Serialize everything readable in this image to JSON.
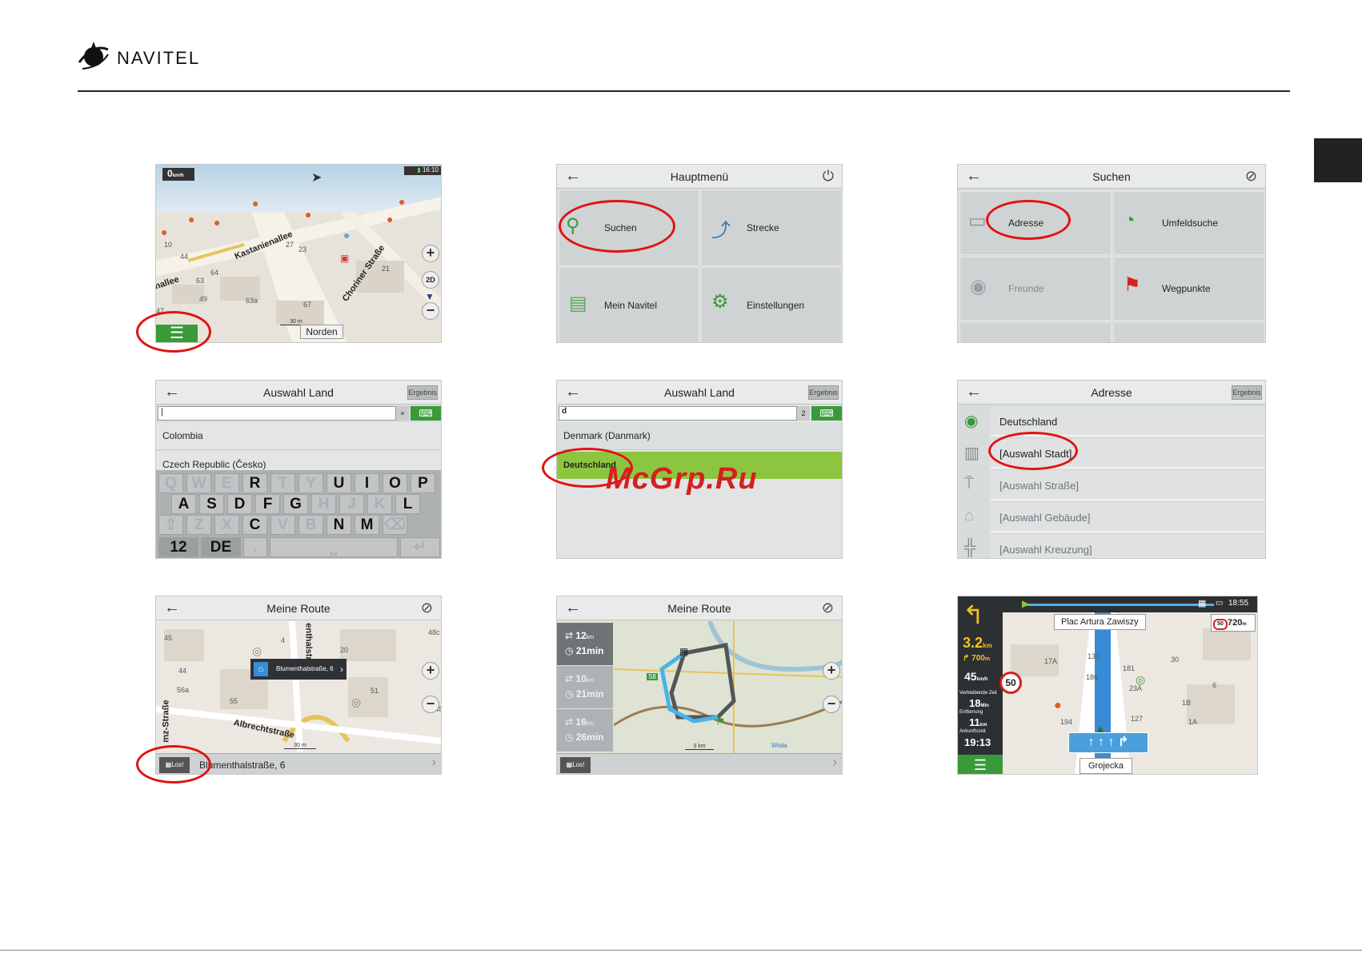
{
  "brand": {
    "name": "NAVITEL"
  },
  "watermark": "McGrp.Ru",
  "map_screen": {
    "speed": "0",
    "speed_unit": "km/h",
    "time": "16:10",
    "streets": [
      "Kastanienallee",
      "Choriner Straße",
      "nallee"
    ],
    "numbers": [
      "44",
      "63",
      "64",
      "49",
      "63a",
      "67",
      "47",
      "27",
      "23",
      "21",
      "10"
    ],
    "scale": "30 m",
    "view_mode": "2D",
    "north_button": "Norden",
    "menu_icon": "menu-icon"
  },
  "main_menu": {
    "title": "Hauptmenü",
    "tiles": [
      {
        "label": "Suchen",
        "icon": "search-icon"
      },
      {
        "label": "Strecke",
        "icon": "route-icon"
      },
      {
        "label": "Mein Navitel",
        "icon": "bag-icon"
      },
      {
        "label": "Einstellungen",
        "icon": "gear-icon"
      }
    ]
  },
  "search_menu": {
    "title": "Suchen",
    "tiles": [
      {
        "label": "Adresse",
        "icon": "address-icon"
      },
      {
        "label": "Umfeldsuche",
        "icon": "nearby-icon"
      },
      {
        "label": "Freunde",
        "icon": "friends-icon"
      },
      {
        "label": "Wegpunkte",
        "icon": "flag-icon"
      }
    ]
  },
  "country_keyboard": {
    "title": "Auswahl Land",
    "results_button": "Ergebnis",
    "input_value": "|",
    "list": [
      "Colombia",
      "Czech Republic (Česko)"
    ],
    "rows": [
      [
        "Q",
        "W",
        "E",
        "R",
        "T",
        "Y",
        "U",
        "I",
        "O",
        "P"
      ],
      [
        "A",
        "S",
        "D",
        "F",
        "G",
        "H",
        "J",
        "K",
        "L"
      ],
      [
        "⇧",
        "Z",
        "X",
        "C",
        "V",
        "B",
        "N",
        "M",
        "⌫"
      ]
    ],
    "enabled_keys": [
      "R",
      "U",
      "I",
      "O",
      "P",
      "A",
      "S",
      "D",
      "F",
      "G",
      "L",
      "C",
      "N",
      "M"
    ],
    "bottom": {
      "num": "12",
      "lang": "DE",
      "dot": ".",
      "space": "⎵",
      "enter": "↵"
    }
  },
  "country_result": {
    "title": "Auswahl Land",
    "results_button": "Ergebnis",
    "input_value": "d",
    "count": "2",
    "list": [
      "Denmark (Danmark)",
      "Deutschland"
    ]
  },
  "address": {
    "title": "Adresse",
    "results_button": "Ergebnis",
    "rows": [
      {
        "label": "Deutschland",
        "icon": "globe-icon",
        "enabled": true
      },
      {
        "label": "[Auswahl Stadt]",
        "icon": "city-icon",
        "enabled": true
      },
      {
        "label": "[Auswahl Straße]",
        "icon": "street-icon",
        "enabled": false
      },
      {
        "label": "[Auswahl Gebäude]",
        "icon": "building-icon",
        "enabled": false
      },
      {
        "label": "[Auswahl Kreuzung]",
        "icon": "crossing-icon",
        "enabled": false
      }
    ]
  },
  "route_map": {
    "title": "Meine Route",
    "popup": "Blumenthalstraße, 6",
    "go_button": "Los!",
    "address": "Blumenthalstraße, 6",
    "streets": [
      "Albrechtstraße",
      "enthalstraße",
      "mz-Straße"
    ],
    "numbers": [
      "45",
      "44",
      "56a",
      "55",
      "4",
      "20",
      "51",
      "48",
      "48c",
      "19"
    ],
    "scale": "30 m"
  },
  "route_options": {
    "title": "Meine Route",
    "go_button": "Los!",
    "options": [
      {
        "distance": "12",
        "dist_unit": "km",
        "time": "21min"
      },
      {
        "distance": "10",
        "dist_unit": "km",
        "time": "21min"
      },
      {
        "distance": "16",
        "dist_unit": "km",
        "time": "26min"
      }
    ],
    "labels": [
      "S8",
      "Wisła"
    ],
    "scale": "3 km"
  },
  "navigation": {
    "time": "18:55",
    "next_street": "Plac Artura Zawiszy",
    "turn_distance": "3.2",
    "turn_unit": "km",
    "next_distance": "700",
    "next_unit": "m",
    "speed": "45",
    "speed_unit": "km/h",
    "speed_limit": "50",
    "camera_limit": "50",
    "camera_distance": "720",
    "camera_unit": "m",
    "remaining_time_label": "Verbleibende Zeit",
    "remaining_time": "18",
    "remaining_time_unit": "Min",
    "distance_label": "Entfernung",
    "distance": "11",
    "distance_unit": "km",
    "arrival_label": "Ankunftszeit",
    "arrival": "19:13",
    "current_street": "Grojecka",
    "numbers": [
      "181",
      "186",
      "194",
      "127",
      "23A",
      "1B",
      "1A",
      "130",
      "17A",
      "30",
      "6"
    ]
  }
}
